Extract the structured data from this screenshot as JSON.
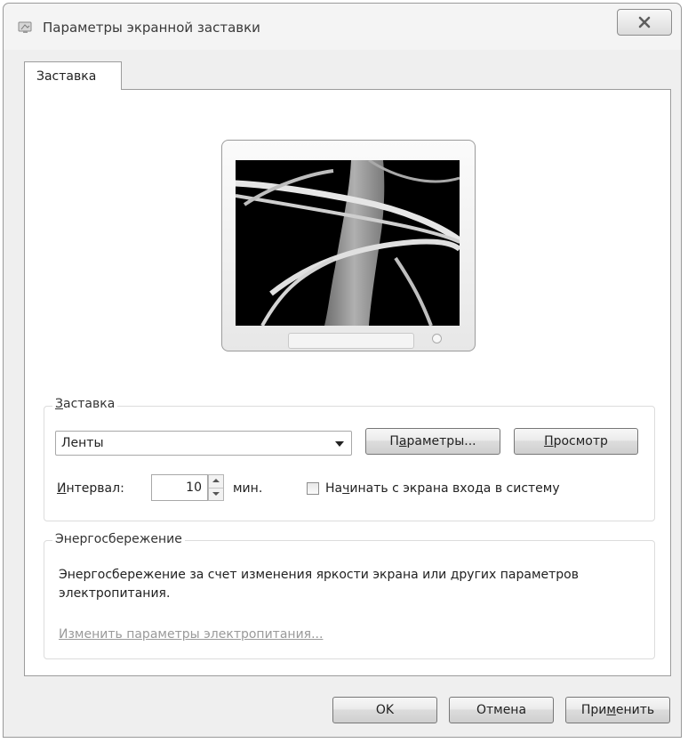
{
  "window": {
    "title": "Параметры экранной заставки"
  },
  "tabs": [
    {
      "label": "Заставка"
    }
  ],
  "screensaver_group": {
    "title_accel": "З",
    "title_rest": "аставка",
    "selected": "Ленты",
    "params_button": {
      "pre": "П",
      "accel": "а",
      "post": "раметры..."
    },
    "preview_button": {
      "pre": "",
      "accel": "П",
      "post": "росмотр"
    },
    "interval_label": {
      "accel": "И",
      "post": "нтервал:"
    },
    "interval_value": "10",
    "interval_unit": "мин.",
    "logon_checkbox": {
      "pre": "На",
      "accel": "ч",
      "post": "инать с экрана входа в систему",
      "checked": false
    }
  },
  "power_group": {
    "title": "Энергосбережение",
    "description": "Энергосбережение за счет изменения яркости экрана или других параметров электропитания.",
    "link": "Изменить параметры электропитания..."
  },
  "footer": {
    "ok": "OK",
    "cancel": "Отмена",
    "apply": {
      "pre": "При",
      "accel": "м",
      "post": "енить"
    }
  }
}
